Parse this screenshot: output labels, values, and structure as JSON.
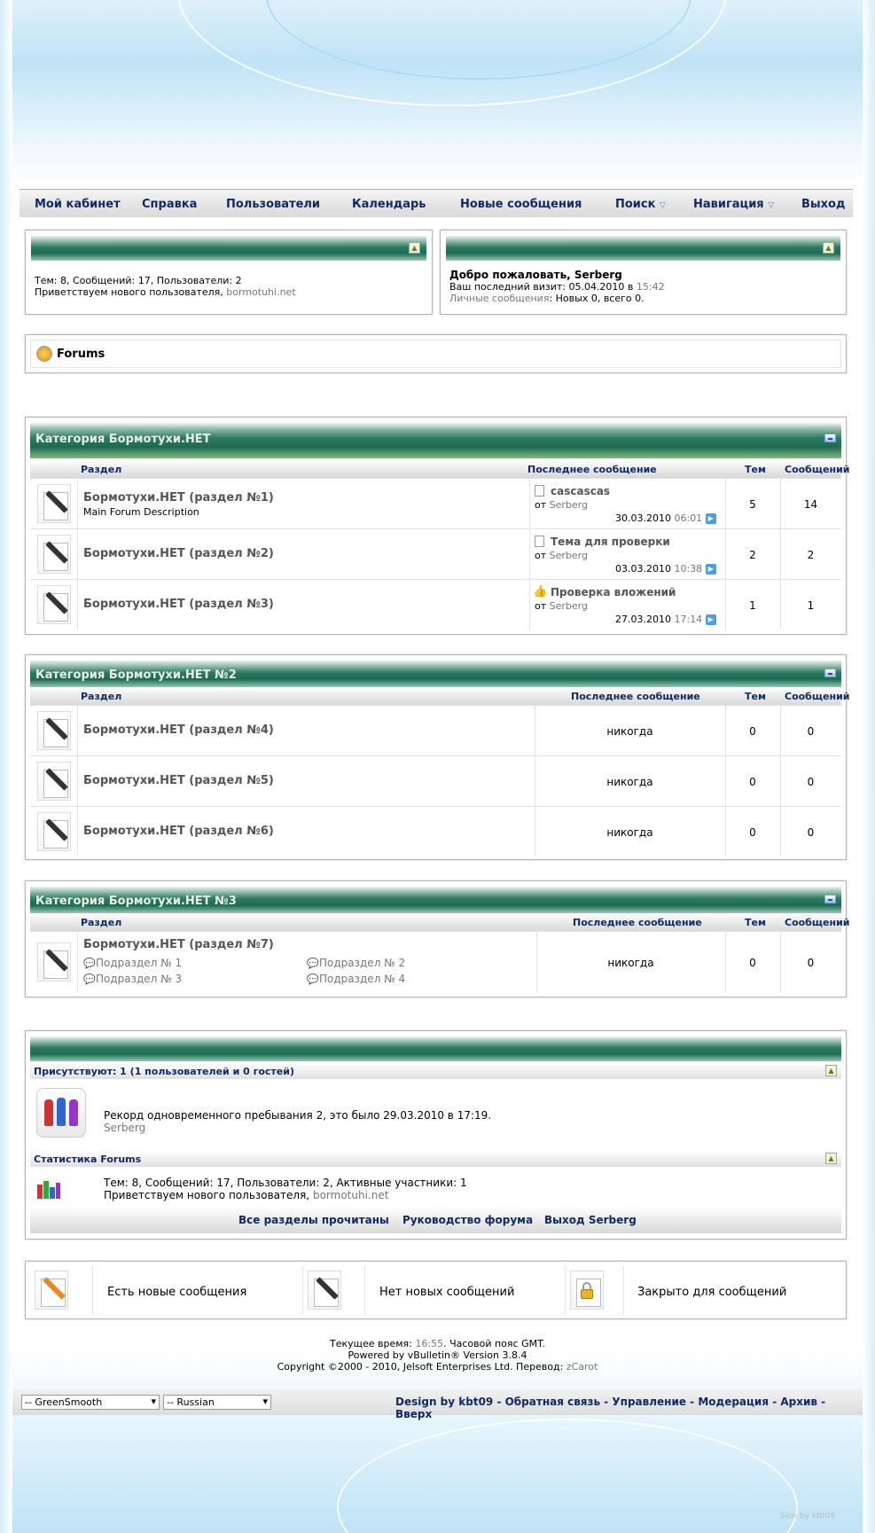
{
  "nav": {
    "items": [
      "Мой кабинет",
      "Справка",
      "Пользователи",
      "Календарь",
      "Новые сообщения",
      "Поиск",
      "Навигация",
      "Выход"
    ]
  },
  "stats_box": {
    "line1": "Тем: 8, Сообщений: 17, Пользователи: 2",
    "welcome_prefix": "Приветствуем нового пользователя,",
    "new_user": "bormotuhi.net"
  },
  "welcome_box": {
    "title": "Добро пожаловать, Serberg",
    "last_visit_prefix": "Ваш последний визит: 05.04.2010 в",
    "last_visit_time": "15:42",
    "pm_label": "Личные сообщения",
    "pm_value": ": Новых 0, всего 0."
  },
  "breadcrumb": {
    "label": "Forums"
  },
  "headers": {
    "section": "Раздел",
    "last_post": "Последнее сообщение",
    "threads": "Тем",
    "posts": "Сообщений"
  },
  "categories": [
    {
      "title": "Категория Бормотухи.НЕТ",
      "forums": [
        {
          "name": "Бормотухи.НЕТ (раздел №1)",
          "description": "Main Forum Description",
          "thread": "cascascas",
          "by": "от",
          "user": "Serberg",
          "date": "30.03.2010",
          "time": "06:01",
          "threads": "5",
          "posts": "14"
        },
        {
          "name": "Бормотухи.НЕТ (раздел №2)",
          "thread": "Тема для проверки",
          "by": "от",
          "user": "Serberg",
          "date": "03.03.2010",
          "time": "10:38",
          "threads": "2",
          "posts": "2"
        },
        {
          "name": "Бормотухи.НЕТ (раздел №3)",
          "thread": "Проверка вложений",
          "by": "от",
          "user": "Serberg",
          "date": "27.03.2010",
          "time": "17:14",
          "threads": "1",
          "posts": "1"
        }
      ]
    },
    {
      "title": "Категория Бормотухи.НЕТ №2",
      "forums": [
        {
          "name": "Бормотухи.НЕТ (раздел №4)",
          "last": "никогда",
          "threads": "0",
          "posts": "0"
        },
        {
          "name": "Бормотухи.НЕТ (раздел №5)",
          "last": "никогда",
          "threads": "0",
          "posts": "0"
        },
        {
          "name": "Бормотухи.НЕТ (раздел №6)",
          "last": "никогда",
          "threads": "0",
          "posts": "0"
        }
      ]
    },
    {
      "title": "Категория Бормотухи.НЕТ №3",
      "forums": [
        {
          "name": "Бормотухи.НЕТ (раздел №7)",
          "subforums": [
            "Подраздел № 1",
            "Подраздел № 2",
            "Подраздел № 3",
            "Подраздел № 4"
          ],
          "last": "никогда",
          "threads": "0",
          "posts": "0"
        }
      ]
    }
  ],
  "whos_online": {
    "header": "Присутствуют: 1 (1 пользователей и 0 гостей)",
    "record": "Рекорд одновременного пребывания 2, это было 29.03.2010 в 17:19.",
    "user": "Serberg"
  },
  "forum_stats": {
    "header": "Статистика Forums",
    "line1": "Тем: 8, Сообщений: 17, Пользователи: 2, Активные участники: 1",
    "welcome_prefix": "Приветствуем нового пользователя,",
    "new_user": "bormotuhi.net"
  },
  "footer_links": [
    "Все разделы прочитаны",
    "Руководство форума",
    "Выход Serberg"
  ],
  "legend": {
    "new": "Есть новые сообщения",
    "no_new": "Нет новых сообщений",
    "closed": "Закрыто для сообщений"
  },
  "bottom": {
    "time_prefix": "Текущее время:",
    "time": "16:55",
    "time_suffix": ". Часовой пояс GMT.",
    "powered": "Powered by vBulletin® Version 3.8.4",
    "copyright_prefix": "Copyright ©2000 - 2010, Jelsoft Enterprises Ltd. Перевод:",
    "translator": "zCarot"
  },
  "style_select": "-- GreenSmooth",
  "lang_select": "-- Russian",
  "bottom_links": "Design by kbt09 - Обратная связь - Управление - Модерация - Архив - Вверх",
  "skin_credit": "Skin by kbt09"
}
